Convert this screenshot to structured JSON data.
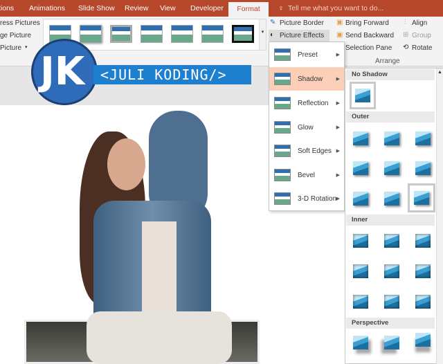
{
  "tabs": [
    "Animations",
    "Slide Show",
    "Review",
    "View",
    "Developer"
  ],
  "tab_partial": "tions",
  "active_tab": "Format",
  "tell_me": "Tell me what you want to do...",
  "ribbon": {
    "adjust": [
      "ress Pictures",
      "ge Picture",
      "Picture"
    ],
    "picture_border": "Picture Border",
    "picture_effects": "Picture Effects",
    "arrange": {
      "bring_forward": "Bring Forward",
      "send_backward": "Send Backward",
      "selection_pane": "Selection Pane",
      "align": "Align",
      "group": "Group",
      "rotate": "Rotate",
      "label": "Arrange"
    }
  },
  "banner": "<JULI KODING/>",
  "logo_text": "JK",
  "effects_menu": [
    "Preset",
    "Shadow",
    "Reflection",
    "Glow",
    "Soft Edges",
    "Bevel",
    "3-D Rotation"
  ],
  "selected_effect": "Shadow",
  "shadow_panel": {
    "no_shadow": "No Shadow",
    "outer": "Outer",
    "inner": "Inner",
    "perspective": "Perspective"
  },
  "colors": {
    "tabbar": "#b7472a",
    "highlight": "#fcd0b8",
    "banner": "#1f7fcf"
  }
}
